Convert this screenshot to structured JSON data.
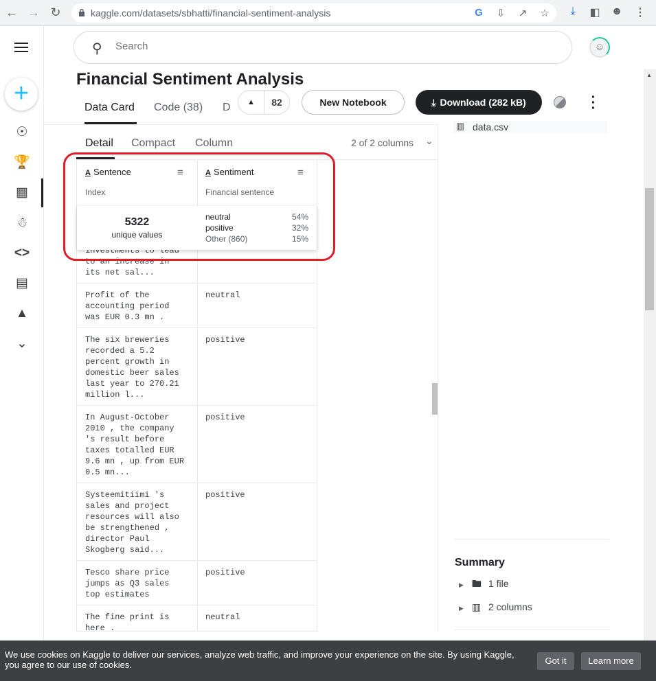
{
  "browser": {
    "url": "kaggle.com/datasets/sbhatti/financial-sentiment-analysis"
  },
  "search": {
    "placeholder": "Search"
  },
  "page": {
    "title": "Financial Sentiment Analysis",
    "tabs": [
      "Data Card",
      "Code (38)",
      "D"
    ],
    "vote_count": "82",
    "new_notebook_label": "New Notebook",
    "download_label": "Download (282 kB)"
  },
  "table": {
    "view_tabs": [
      "Detail",
      "Compact",
      "Column"
    ],
    "column_count": "2 of 2 columns",
    "columns": [
      {
        "name": "Sentence",
        "description": "Index"
      },
      {
        "name": "Sentiment",
        "description": "Financial sentence"
      }
    ],
    "stats": {
      "unique_count": "5322",
      "unique_label": "unique values",
      "distribution": [
        {
          "label": "neutral",
          "pct": "54%"
        },
        {
          "label": "positive",
          "pct": "32%"
        },
        {
          "label": "Other (860)",
          "pct": "15%"
        }
      ]
    },
    "partial_row": "investments to lead\nto an increase in\nits net sal...",
    "rows": [
      {
        "sentence": "Profit of the\naccounting period\nwas EUR 0.3 mn .",
        "sentiment": "neutral"
      },
      {
        "sentence": "The six breweries\nrecorded a 5.2\npercent growth in\ndomestic beer sales\nlast year to 270.21\nmillion l...",
        "sentiment": "positive"
      },
      {
        "sentence": "In August-October\n2010 , the company\n's result before\ntaxes totalled EUR\n9.6 mn , up from EUR\n0.5 mn...",
        "sentiment": "positive"
      },
      {
        "sentence": "Systeemitiimi 's\nsales and project\nresources will also\nbe strengthened ,\ndirector Paul\nSkogberg said...",
        "sentiment": "positive"
      },
      {
        "sentence": "Tesco share price\njumps as Q3 sales\ntop estimates",
        "sentiment": "positive"
      },
      {
        "sentence": "The fine print is\nhere .",
        "sentiment": "neutral"
      }
    ]
  },
  "sidebar_right": {
    "file_name": "data.csv",
    "summary_title": "Summary",
    "summary_items": [
      "1 file",
      "2 columns"
    ]
  },
  "cookie": {
    "message": "We use cookies on Kaggle to deliver our services, analyze web traffic, and improve your experience on the site. By using Kaggle, you agree to our use of cookies.",
    "got_it": "Got it",
    "learn_more": "Learn more"
  },
  "colors": {
    "accent": "#20beff",
    "highlight": "#e11d2a",
    "dark_button": "#202124"
  }
}
